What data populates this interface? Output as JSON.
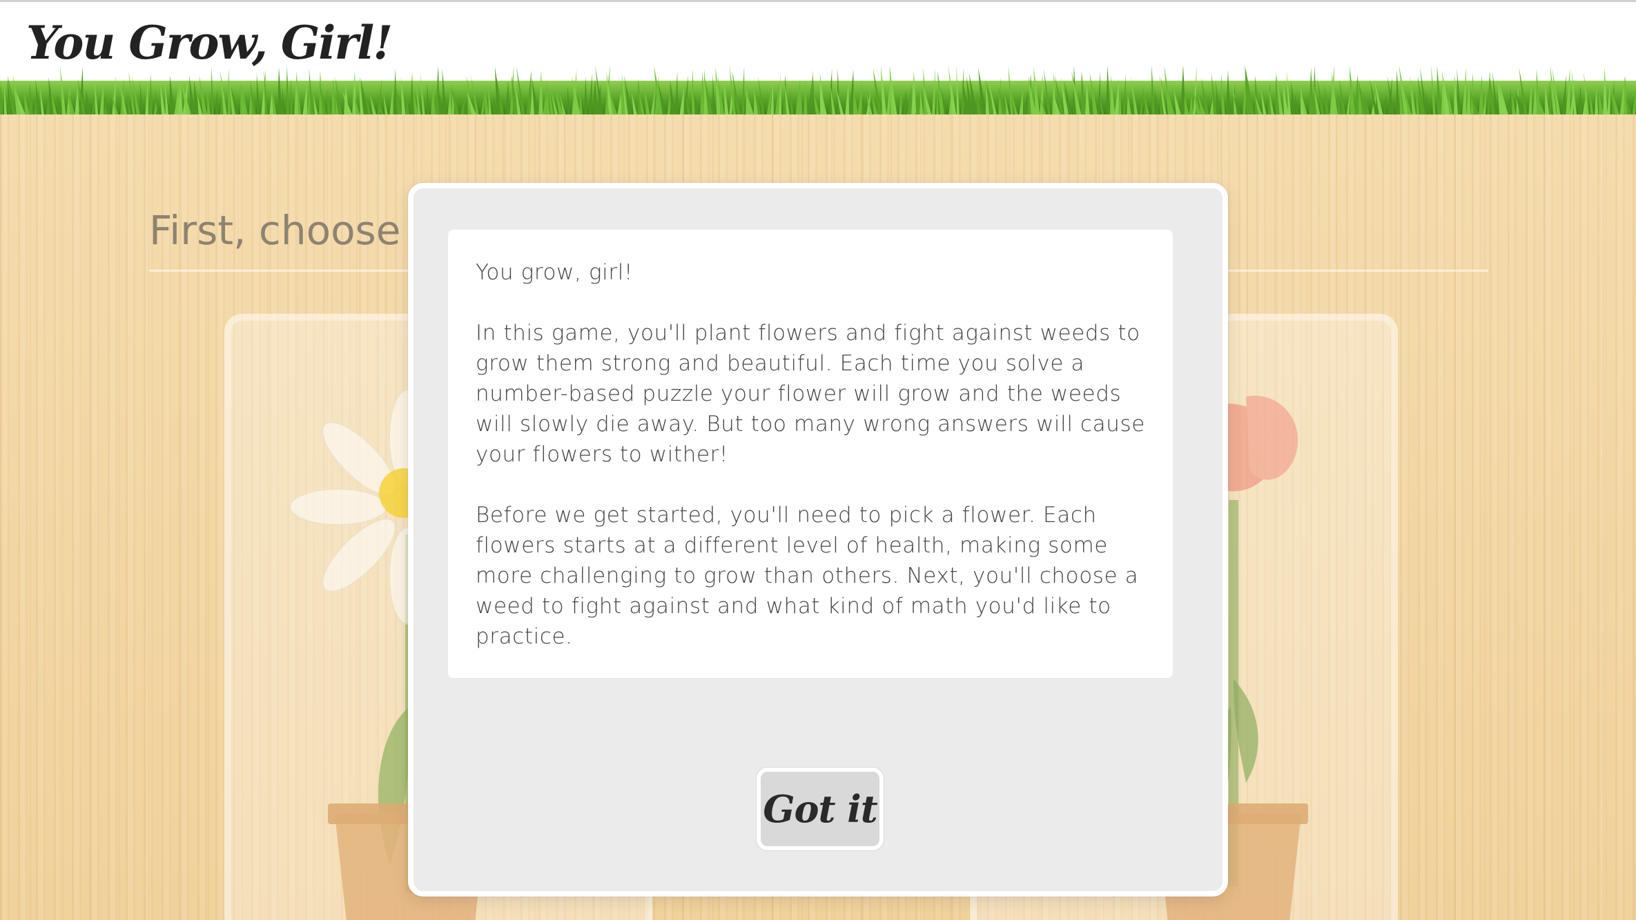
{
  "app": {
    "title": "You Grow, Girl!"
  },
  "page": {
    "heading": "First, choose v"
  },
  "modal": {
    "greeting": "You grow, girl!",
    "paragraph_1": "In this game, you'll plant flowers and fight against weeds to grow them strong and beautiful. Each time you solve a number-based puzzle your flower will grow and the weeds will slowly die away. But too many wrong answers will cause your flowers to wither!",
    "paragraph_2": "Before we get started, you'll need to pick a flower. Each flowers starts at a different level of health, making some more challenging to grow than others. Next, you'll choose a weed to fight against and what kind of math you'd like to practice.",
    "button_label": "Got it"
  },
  "flowers": [
    {
      "name": "daisy-icon"
    },
    {
      "name": "poppy-icon"
    }
  ],
  "colors": {
    "grass": "#5da52a",
    "wood": "#f2d5a2",
    "modal_bg": "#ebebeb",
    "text": "#444444"
  }
}
